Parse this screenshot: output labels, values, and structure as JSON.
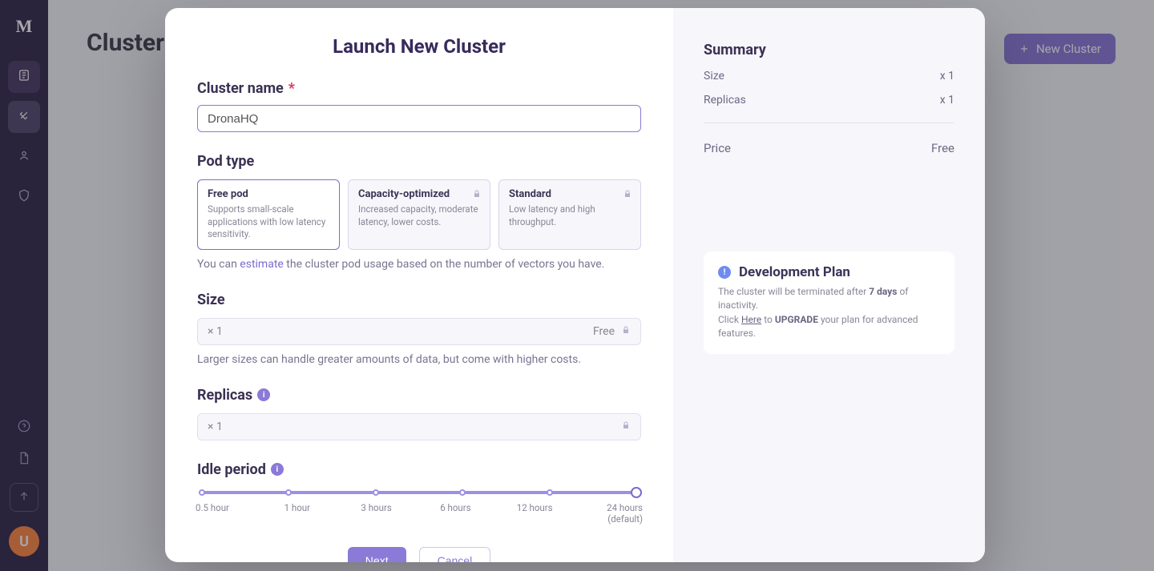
{
  "page": {
    "title": "Clusters",
    "new_cluster_btn": "New Cluster"
  },
  "sidebar": {
    "logo": "M",
    "avatar_initial": "U"
  },
  "modal": {
    "title": "Launch New Cluster",
    "cluster_name": {
      "label": "Cluster name",
      "value": "DronaHQ"
    },
    "pod_type": {
      "label": "Pod type",
      "options": [
        {
          "title": "Free pod",
          "desc": "Supports small-scale applications with low latency sensitivity.",
          "locked": false,
          "selected": true
        },
        {
          "title": "Capacity-optimized",
          "desc": "Increased capacity, moderate latency, lower costs.",
          "locked": true,
          "selected": false
        },
        {
          "title": "Standard",
          "desc": "Low latency and high throughput.",
          "locked": true,
          "selected": false
        }
      ],
      "hint_prefix": "You can ",
      "hint_link": "estimate",
      "hint_suffix": " the cluster pod usage based on the number of vectors you have."
    },
    "size": {
      "label": "Size",
      "value": "× 1",
      "badge": "Free",
      "hint": "Larger sizes can handle greater amounts of data, but come with higher costs."
    },
    "replicas": {
      "label": "Replicas",
      "value": "× 1"
    },
    "idle": {
      "label": "Idle period",
      "ticks": [
        "0.5 hour",
        "1 hour",
        "3 hours",
        "6 hours",
        "12 hours",
        "24 hours"
      ],
      "default_suffix": "(default)",
      "selected_index": 5
    },
    "buttons": {
      "next": "Next",
      "cancel": "Cancel"
    }
  },
  "summary": {
    "title": "Summary",
    "rows": [
      {
        "label": "Size",
        "value": "x 1"
      },
      {
        "label": "Replicas",
        "value": "x 1"
      }
    ],
    "price_label": "Price",
    "price_value": "Free"
  },
  "plan": {
    "title": "Development Plan",
    "line1_prefix": "The cluster will be terminated after ",
    "line1_bold": "7 days",
    "line1_suffix": " of inactivity.",
    "line2_prefix": "Click ",
    "line2_link": "Here",
    "line2_mid": " to ",
    "line2_bold": "UPGRADE",
    "line2_suffix": " your plan for advanced features."
  }
}
